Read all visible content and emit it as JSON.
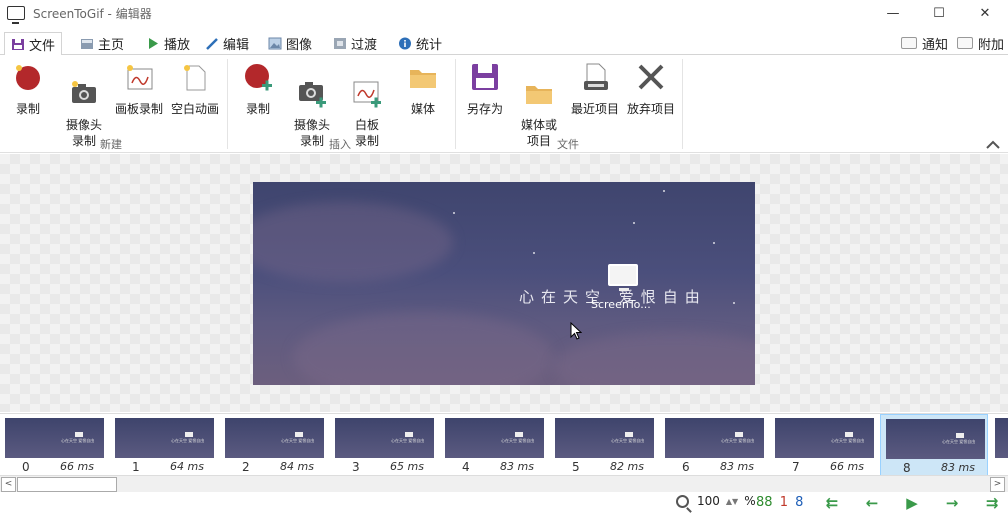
{
  "window": {
    "title": "ScreenToGif - 编辑器",
    "minimize": "—",
    "maximize": "☐",
    "close": "✕"
  },
  "tabs": [
    {
      "label": "文件",
      "icon": "save-icon",
      "active": true
    },
    {
      "label": "主页",
      "icon": "home-icon"
    },
    {
      "label": "播放",
      "icon": "play-icon"
    },
    {
      "label": "编辑",
      "icon": "pencil-icon"
    },
    {
      "label": "图像",
      "icon": "image-icon"
    },
    {
      "label": "过渡",
      "icon": "transition-icon"
    },
    {
      "label": "统计",
      "icon": "info-icon"
    }
  ],
  "right_tabs": [
    {
      "label": "通知",
      "icon": "notification-icon"
    },
    {
      "label": "附加",
      "icon": "attachment-icon"
    }
  ],
  "ribbon": {
    "groups": [
      {
        "label": "新建",
        "buttons": [
          {
            "label": "录制",
            "icon": "record-icon"
          },
          {
            "label": "摄像头\n录制",
            "icon": "webcam-icon"
          },
          {
            "label": "画板录制",
            "icon": "board-icon"
          },
          {
            "label": "空白动画",
            "icon": "blank-file-icon"
          }
        ]
      },
      {
        "label": "插入",
        "buttons": [
          {
            "label": "录制",
            "icon": "record-add-icon"
          },
          {
            "label": "摄像头\n录制",
            "icon": "webcam-add-icon"
          },
          {
            "label": "白板\n录制",
            "icon": "board-add-icon"
          },
          {
            "label": "媒体",
            "icon": "folder-icon"
          }
        ]
      },
      {
        "label": "文件",
        "buttons": [
          {
            "label": "另存为",
            "icon": "save-as-icon"
          },
          {
            "label": "媒体或\n项目",
            "icon": "open-folder-icon"
          },
          {
            "label": "最近项目",
            "icon": "recent-projects-icon"
          },
          {
            "label": "放弃项目",
            "icon": "discard-icon"
          }
        ]
      }
    ],
    "collapse_icon": "chevron-up-icon"
  },
  "canvas": {
    "poem": "心在天空  爱恨自由",
    "overlay_label": "ScreenTo..."
  },
  "frames": [
    {
      "index": "0",
      "delay": "66 ms"
    },
    {
      "index": "1",
      "delay": "64 ms"
    },
    {
      "index": "2",
      "delay": "84 ms"
    },
    {
      "index": "3",
      "delay": "65 ms"
    },
    {
      "index": "4",
      "delay": "83 ms"
    },
    {
      "index": "5",
      "delay": "82 ms"
    },
    {
      "index": "6",
      "delay": "83 ms"
    },
    {
      "index": "7",
      "delay": "66 ms"
    },
    {
      "index": "8",
      "delay": "83 ms",
      "selected": true
    }
  ],
  "status": {
    "zoom_value": "100",
    "zoom_unit": "%",
    "frame_count": "88",
    "selected_count": "1",
    "current_index": "8",
    "colors": {
      "frame_count": "#2e8b2e",
      "selected_count": "#c0392b",
      "current_index": "#1f5fb8"
    }
  }
}
